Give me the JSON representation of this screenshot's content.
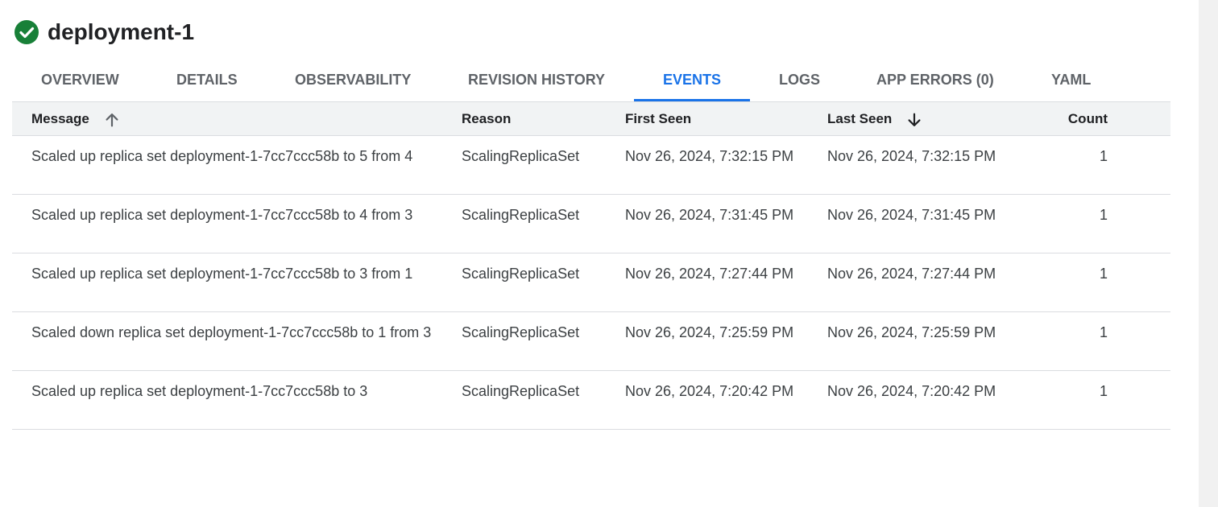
{
  "header": {
    "status_icon": "check-circle-icon",
    "title": "deployment-1"
  },
  "tabs": [
    {
      "label": "OVERVIEW",
      "active": false
    },
    {
      "label": "DETAILS",
      "active": false
    },
    {
      "label": "OBSERVABILITY",
      "active": false
    },
    {
      "label": "REVISION HISTORY",
      "active": false
    },
    {
      "label": "EVENTS",
      "active": true
    },
    {
      "label": "LOGS",
      "active": false
    },
    {
      "label": "APP ERRORS (0)",
      "active": false
    },
    {
      "label": "YAML",
      "active": false
    }
  ],
  "table": {
    "columns": {
      "message": "Message",
      "reason": "Reason",
      "first_seen": "First Seen",
      "last_seen": "Last Seen",
      "count": "Count"
    },
    "sort": {
      "message": "arrow-up-icon",
      "last_seen": "arrow-down-icon"
    },
    "rows": [
      {
        "message": "Scaled up replica set deployment-1-7cc7ccc58b to 5 from 4",
        "reason": "ScalingReplicaSet",
        "first_seen": "Nov 26, 2024, 7:32:15 PM",
        "last_seen": "Nov 26, 2024, 7:32:15 PM",
        "count": "1"
      },
      {
        "message": "Scaled up replica set deployment-1-7cc7ccc58b to 4 from 3",
        "reason": "ScalingReplicaSet",
        "first_seen": "Nov 26, 2024, 7:31:45 PM",
        "last_seen": "Nov 26, 2024, 7:31:45 PM",
        "count": "1"
      },
      {
        "message": "Scaled up replica set deployment-1-7cc7ccc58b to 3 from 1",
        "reason": "ScalingReplicaSet",
        "first_seen": "Nov 26, 2024, 7:27:44 PM",
        "last_seen": "Nov 26, 2024, 7:27:44 PM",
        "count": "1"
      },
      {
        "message": "Scaled down replica set deployment-1-7cc7ccc58b to 1 from 3",
        "reason": "ScalingReplicaSet",
        "first_seen": "Nov 26, 2024, 7:25:59 PM",
        "last_seen": "Nov 26, 2024, 7:25:59 PM",
        "count": "1"
      },
      {
        "message": "Scaled up replica set deployment-1-7cc7ccc58b to 3",
        "reason": "ScalingReplicaSet",
        "first_seen": "Nov 26, 2024, 7:20:42 PM",
        "last_seen": "Nov 26, 2024, 7:20:42 PM",
        "count": "1"
      }
    ]
  },
  "colors": {
    "accent": "#1a73e8",
    "success": "#188038"
  }
}
